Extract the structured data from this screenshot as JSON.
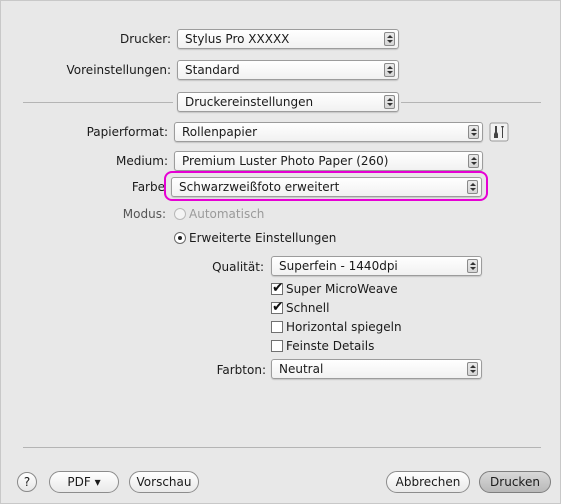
{
  "fields": {
    "drucker": {
      "label": "Drucker:",
      "value": "Stylus Pro XXXXX"
    },
    "voreinstellungen": {
      "label": "Voreinstellungen:",
      "value": "Standard"
    },
    "panel": {
      "value": "Druckereinstellungen"
    },
    "papierformat": {
      "label": "Papierformat:",
      "value": "Rollenpapier"
    },
    "medium": {
      "label": "Medium:",
      "value": "Premium Luster Photo Paper (260)"
    },
    "farbe": {
      "label": "Farbe",
      "value": "Schwarzweißfoto erweitert"
    },
    "qualitaet": {
      "label": "Qualität:",
      "value": "Superfein - 1440dpi"
    },
    "farbton": {
      "label": "Farbton:",
      "value": "Neutral"
    }
  },
  "modus": {
    "label": "Modus:",
    "automatisch": "Automatisch",
    "erweitert": "Erweiterte Einstellungen"
  },
  "options": {
    "super_microweave": {
      "label": "Super MicroWeave",
      "checked": true
    },
    "schnell": {
      "label": "Schnell",
      "checked": true
    },
    "horizontal_spiegeln": {
      "label": "Horizontal spiegeln",
      "checked": false
    },
    "feinste_details": {
      "label": "Feinste Details",
      "checked": false
    }
  },
  "buttons": {
    "help": "?",
    "pdf": "PDF ▾",
    "vorschau": "Vorschau",
    "abbrechen": "Abbrechen",
    "drucken": "Drucken"
  },
  "colors": {
    "highlight": "#e600d4"
  }
}
